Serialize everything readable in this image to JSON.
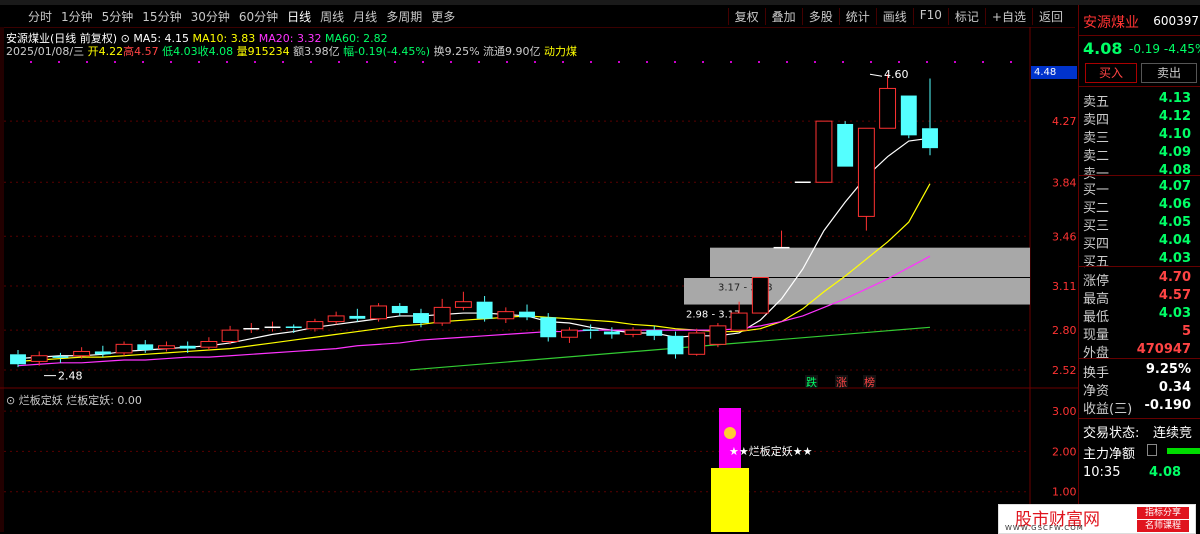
{
  "toolbar": {
    "periods": [
      "分时",
      "1分钟",
      "5分钟",
      "15分钟",
      "30分钟",
      "60分钟",
      "日线",
      "周线",
      "月线",
      "多周期",
      "更多"
    ],
    "active_period": "日线",
    "right_buttons": [
      "复权",
      "叠加",
      "多股",
      "统计",
      "画线",
      "F10",
      "标记",
      "+自选",
      "返回"
    ]
  },
  "info": {
    "stock_name": "安源煤业",
    "chart_mode": "(日线 前复权)",
    "ma5": "MA5: 4.15",
    "ma10": "MA10: 3.83",
    "ma20": "MA20: 3.32",
    "ma60": "MA60: 2.82",
    "date": "2025/01/08/三",
    "open": "开4.22",
    "high": "高4.57",
    "low": "低4.03",
    "close": "收4.08",
    "volume": "量915234",
    "amount": "额3.98亿",
    "amplitude": "幅-0.19(-4.45%)",
    "turnover": "换9.25%",
    "float": "流通9.90亿",
    "sector": "动力煤"
  },
  "sub_indicator": {
    "name": "烂板定妖",
    "value_line": "烂板定妖: 0.00",
    "tag": "★★烂板定妖★★"
  },
  "chart_data": {
    "type": "candlestick",
    "ylim": [
      2.4,
      4.7
    ],
    "y_ticks": [
      "4.27",
      "3.84",
      "3.46",
      "3.11",
      "2.80",
      "2.52"
    ],
    "sub_y_ticks": [
      "3.00",
      "2.00",
      "1.00"
    ],
    "current_price_tag": "4.48",
    "annotations": {
      "high_marker": "4.60",
      "low_marker": "2.48",
      "zone1": "3.17 - 3.38",
      "zone2": "2.98 - 3.17"
    },
    "candles": [
      [
        2.63,
        2.56,
        2.66,
        2.54
      ],
      [
        2.58,
        2.62,
        2.65,
        2.55
      ],
      [
        2.61,
        2.6,
        2.64,
        2.57
      ],
      [
        2.62,
        2.65,
        2.68,
        2.6
      ],
      [
        2.65,
        2.63,
        2.69,
        2.61
      ],
      [
        2.64,
        2.7,
        2.72,
        2.62
      ],
      [
        2.7,
        2.66,
        2.73,
        2.64
      ],
      [
        2.67,
        2.69,
        2.72,
        2.65
      ],
      [
        2.69,
        2.67,
        2.72,
        2.64
      ],
      [
        2.68,
        2.72,
        2.75,
        2.66
      ],
      [
        2.72,
        2.8,
        2.83,
        2.7
      ],
      [
        2.8,
        2.81,
        2.85,
        2.78
      ],
      [
        2.81,
        2.82,
        2.86,
        2.79
      ],
      [
        2.82,
        2.81,
        2.84,
        2.78
      ],
      [
        2.81,
        2.86,
        2.88,
        2.79
      ],
      [
        2.86,
        2.9,
        2.93,
        2.84
      ],
      [
        2.9,
        2.88,
        2.95,
        2.86
      ],
      [
        2.88,
        2.97,
        2.99,
        2.86
      ],
      [
        2.97,
        2.92,
        2.99,
        2.9
      ],
      [
        2.92,
        2.85,
        2.95,
        2.82
      ],
      [
        2.85,
        2.96,
        3.02,
        2.83
      ],
      [
        2.96,
        3.0,
        3.07,
        2.94
      ],
      [
        3.0,
        2.88,
        3.04,
        2.86
      ],
      [
        2.88,
        2.93,
        2.96,
        2.85
      ],
      [
        2.93,
        2.89,
        2.98,
        2.87
      ],
      [
        2.89,
        2.75,
        2.92,
        2.72
      ],
      [
        2.75,
        2.8,
        2.82,
        2.71
      ],
      [
        2.8,
        2.79,
        2.84,
        2.74
      ],
      [
        2.79,
        2.77,
        2.82,
        2.74
      ],
      [
        2.77,
        2.8,
        2.82,
        2.75
      ],
      [
        2.8,
        2.76,
        2.83,
        2.73
      ],
      [
        2.76,
        2.63,
        2.79,
        2.6
      ],
      [
        2.63,
        2.78,
        2.81,
        2.62
      ],
      [
        2.7,
        2.83,
        2.85,
        2.68
      ],
      [
        2.8,
        2.92,
        3.0,
        2.79
      ],
      [
        2.92,
        3.17,
        3.17,
        2.92
      ],
      [
        3.38,
        3.38,
        3.5,
        3.38
      ],
      [
        3.84,
        3.84,
        3.84,
        3.84
      ],
      [
        3.84,
        4.27,
        4.27,
        3.84
      ],
      [
        4.25,
        3.95,
        4.27,
        3.95
      ],
      [
        3.6,
        4.22,
        4.22,
        3.5
      ],
      [
        4.22,
        4.5,
        4.6,
        4.22
      ],
      [
        4.45,
        4.17,
        4.45,
        4.15
      ],
      [
        4.22,
        4.08,
        4.57,
        4.03
      ]
    ],
    "ma5": [
      2.6,
      2.61,
      2.62,
      2.62,
      2.63,
      2.65,
      2.66,
      2.67,
      2.68,
      2.69,
      2.71,
      2.74,
      2.77,
      2.79,
      2.82,
      2.84,
      2.86,
      2.88,
      2.9,
      2.9,
      2.91,
      2.92,
      2.92,
      2.91,
      2.9,
      2.86,
      2.85,
      2.82,
      2.8,
      2.78,
      2.78,
      2.75,
      2.76,
      2.76,
      2.78,
      2.87,
      3.02,
      3.23,
      3.5,
      3.7,
      3.88,
      4.02,
      4.13,
      4.15
    ],
    "ma10": [
      2.58,
      2.59,
      2.6,
      2.61,
      2.61,
      2.62,
      2.63,
      2.64,
      2.65,
      2.66,
      2.67,
      2.69,
      2.71,
      2.73,
      2.75,
      2.77,
      2.79,
      2.81,
      2.83,
      2.84,
      2.86,
      2.87,
      2.88,
      2.89,
      2.9,
      2.89,
      2.88,
      2.87,
      2.86,
      2.84,
      2.83,
      2.81,
      2.8,
      2.79,
      2.79,
      2.81,
      2.86,
      2.95,
      3.07,
      3.18,
      3.3,
      3.42,
      3.56,
      3.83
    ],
    "ma20": [
      2.55,
      2.56,
      2.57,
      2.57,
      2.58,
      2.59,
      2.59,
      2.6,
      2.61,
      2.61,
      2.62,
      2.63,
      2.64,
      2.65,
      2.66,
      2.67,
      2.69,
      2.7,
      2.71,
      2.73,
      2.74,
      2.75,
      2.76,
      2.77,
      2.78,
      2.79,
      2.79,
      2.8,
      2.8,
      2.8,
      2.8,
      2.8,
      2.8,
      2.8,
      2.81,
      2.83,
      2.86,
      2.9,
      2.96,
      3.02,
      3.09,
      3.16,
      3.24,
      3.32
    ],
    "ma60_start": 2.52,
    "ma60_end": 2.82
  },
  "right_panel": {
    "name": "安源煤业",
    "code": "600397",
    "price": "4.08",
    "change": "-0.19",
    "change_pct": "-4.45%",
    "buy_label": "买入",
    "sell_label": "卖出",
    "asks": [
      [
        "卖五",
        "4.13"
      ],
      [
        "卖四",
        "4.12"
      ],
      [
        "卖三",
        "4.10"
      ],
      [
        "卖二",
        "4.09"
      ],
      [
        "卖一",
        "4.08"
      ]
    ],
    "bids": [
      [
        "买一",
        "4.07"
      ],
      [
        "买二",
        "4.06"
      ],
      [
        "买三",
        "4.05"
      ],
      [
        "买四",
        "4.04"
      ],
      [
        "买五",
        "4.03"
      ]
    ],
    "stats": [
      [
        "涨停",
        "4.70"
      ],
      [
        "最高",
        "4.57"
      ],
      [
        "最低",
        "4.03"
      ],
      [
        "现量",
        "5"
      ],
      [
        "外盘",
        "470947"
      ]
    ],
    "stats2": [
      [
        "换手",
        "9.25%"
      ],
      [
        "净资",
        "0.34"
      ],
      [
        "收益(三)",
        "-0.190"
      ]
    ],
    "trade_state_label": "交易状态:",
    "trade_state_value": "连续竞",
    "main_flow_label": "主力净额",
    "time": "10:35",
    "time_value": "4.08"
  },
  "zt_marks": [
    "跌",
    "涨",
    "榜"
  ],
  "watermark": {
    "main": "股市财富网",
    "url": "WWW.GSCFW.COM",
    "badge1": "指标分享",
    "badge2": "名师课程"
  }
}
